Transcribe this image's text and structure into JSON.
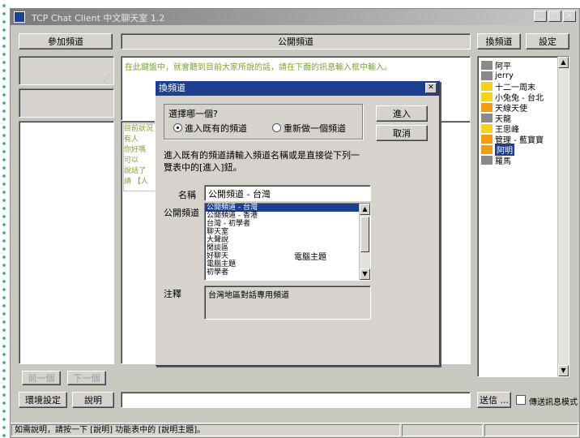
{
  "window": {
    "title": "TCP Chat Client 中文聊天室 1.2",
    "controls": [
      "_",
      "□",
      "×"
    ]
  },
  "toolbar": {
    "join_label": "參加頻道",
    "channel_name": "公開頻道",
    "change_channel_label": "換頻道",
    "settings_label": "設定"
  },
  "chat": {
    "intro_line": "在此鍵盤中，就會聽到目前大家所說的話，請在下面的訊息輸入框中輸入。",
    "left_lines": [
      "目前狀況",
      "有人",
      "你好嗎",
      "可以",
      "說話了",
      "請 【人"
    ]
  },
  "dialog": {
    "title": "換頻道",
    "question": "選擇哪一個?",
    "option_existing": "進入既有的頻道",
    "option_new": "重新做一個頻道",
    "enter_label": "進入",
    "cancel_label": "取消",
    "instructions": "進入既有的頻道請輸入頻道名稱或是直接從下列一覽表中的[進入]鈕。",
    "name_label": "名稱",
    "name_value": "公開頻道 - 台灣",
    "channel_list_label": "公開頻道",
    "channels": [
      {
        "name": "公開頻道 - 台灣",
        "selected": true
      },
      {
        "name": "公開頻道 - 香港",
        "selected": false
      },
      {
        "name": "台灣 - 初學者",
        "selected": false
      },
      {
        "name": "聊天室",
        "selected": false
      },
      {
        "name": "大聲說",
        "selected": false
      },
      {
        "name": "閒談區",
        "selected": false
      },
      {
        "name": "好聊天",
        "selected": false
      },
      {
        "name": "電腦主題",
        "selected": false
      },
      {
        "name": "初學者",
        "selected": false
      }
    ],
    "extra_tag": "電腦主題",
    "note_label": "注釋",
    "note_value": "台灣地區對話專用頻道"
  },
  "users": [
    {
      "name": "阿平",
      "color": "#8a8a8a",
      "selected": false
    },
    {
      "name": "jerry",
      "color": "#8a8a8a",
      "selected": false
    },
    {
      "name": "十二一周末",
      "color": "#f5d21d",
      "selected": false
    },
    {
      "name": "小兔兔 - 台北",
      "color": "#f5d21d",
      "selected": false
    },
    {
      "name": "天線天使",
      "color": "#f39b12",
      "selected": false
    },
    {
      "name": "天龍",
      "color": "#8a8a8a",
      "selected": false
    },
    {
      "name": "王思峰",
      "color": "#f5d21d",
      "selected": false
    },
    {
      "name": "管理 - 藍寶寶",
      "color": "#f39b12",
      "selected": false
    },
    {
      "name": "阿明",
      "color": "#f39b12",
      "selected": true
    },
    {
      "name": "羅馬",
      "color": "#8a8a8a",
      "selected": false
    }
  ],
  "bottom": {
    "prev_label": "前一個",
    "next_label": "下一個",
    "env_settings_label": "環境設定",
    "help_label": "說明",
    "send_label": "送信 ...",
    "send_mode_label": "傳送訊息模式"
  },
  "status": {
    "text": "如需說明，請按一下 [說明] 功能表中的 [說明主題]。"
  },
  "colors": {
    "selection": "#1c3f8f",
    "window_bg": "#c8c8c0",
    "accent_dots": "#2aa79b"
  }
}
